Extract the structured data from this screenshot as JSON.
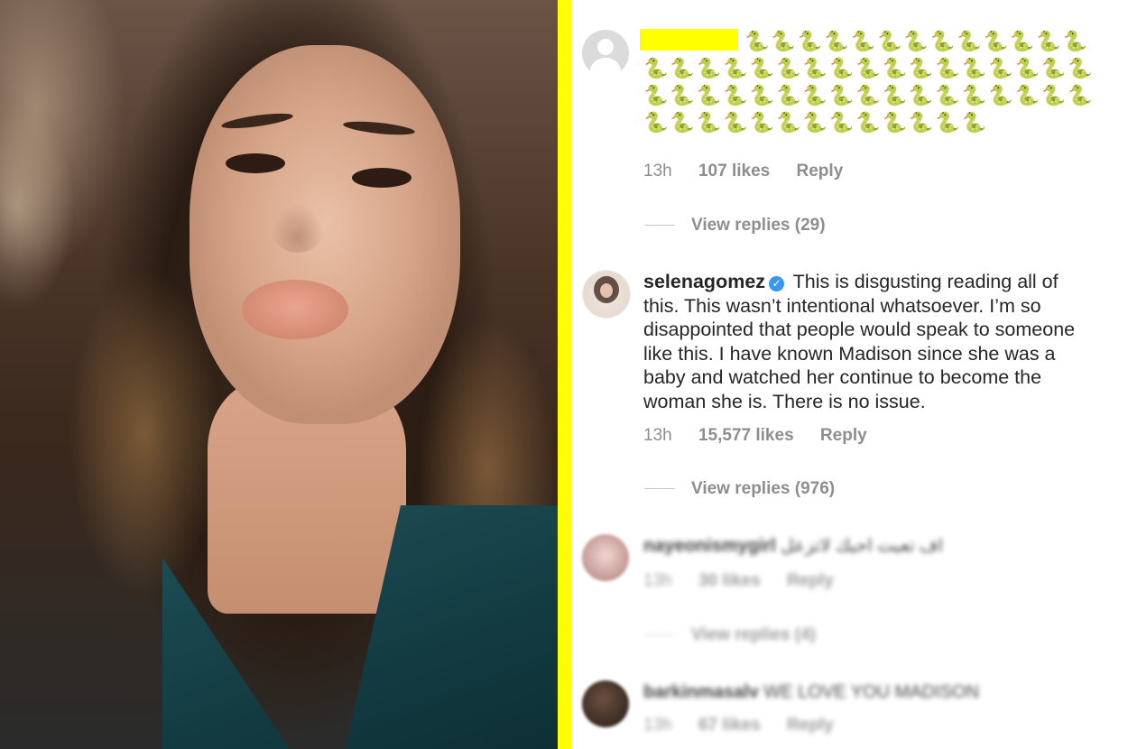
{
  "comments": [
    {
      "snake_emojis": "🐍🐍🐍🐍🐍🐍🐍🐍🐍🐍🐍🐍🐍🐍🐍🐍🐍🐍🐍🐍🐍🐍🐍🐍🐍🐍🐍🐍🐍🐍🐍🐍🐍🐍🐍🐍🐍🐍🐍🐍🐍🐍🐍🐍🐍🐍🐍🐍🐍🐍🐍🐍🐍🐍🐍🐍🐍🐍🐍🐍",
      "time": "13h",
      "likes": "107 likes",
      "reply": "Reply",
      "view_replies": "View replies (29)"
    },
    {
      "username": "selenagomez",
      "verified_icon": "verified-badge-icon",
      "text": "This is disgusting reading all of this. This wasn’t intentional whatsoever. I’m so disappointed that people would speak to someone like this. I have known Madison since she was a baby and watched her continue to become the woman she is. There is no issue.",
      "time": "13h",
      "likes": "15,577 likes",
      "reply": "Reply",
      "view_replies": "View replies (976)"
    },
    {
      "username": "nayeonismygirl",
      "text": "اف تعبت احبك لاتزعل",
      "time": "13h",
      "likes": "30 likes",
      "reply": "Reply",
      "view_replies": "View replies (4)"
    },
    {
      "username": "barkinmasalv",
      "text": "WE LOVE YOU MADISON",
      "time": "13h",
      "likes": "67 likes",
      "reply": "Reply"
    }
  ],
  "colors": {
    "divider": "#ffff00",
    "redaction": "#ffff00",
    "text": "#262626",
    "meta": "#8e8e8e",
    "verified": "#3897f0"
  }
}
